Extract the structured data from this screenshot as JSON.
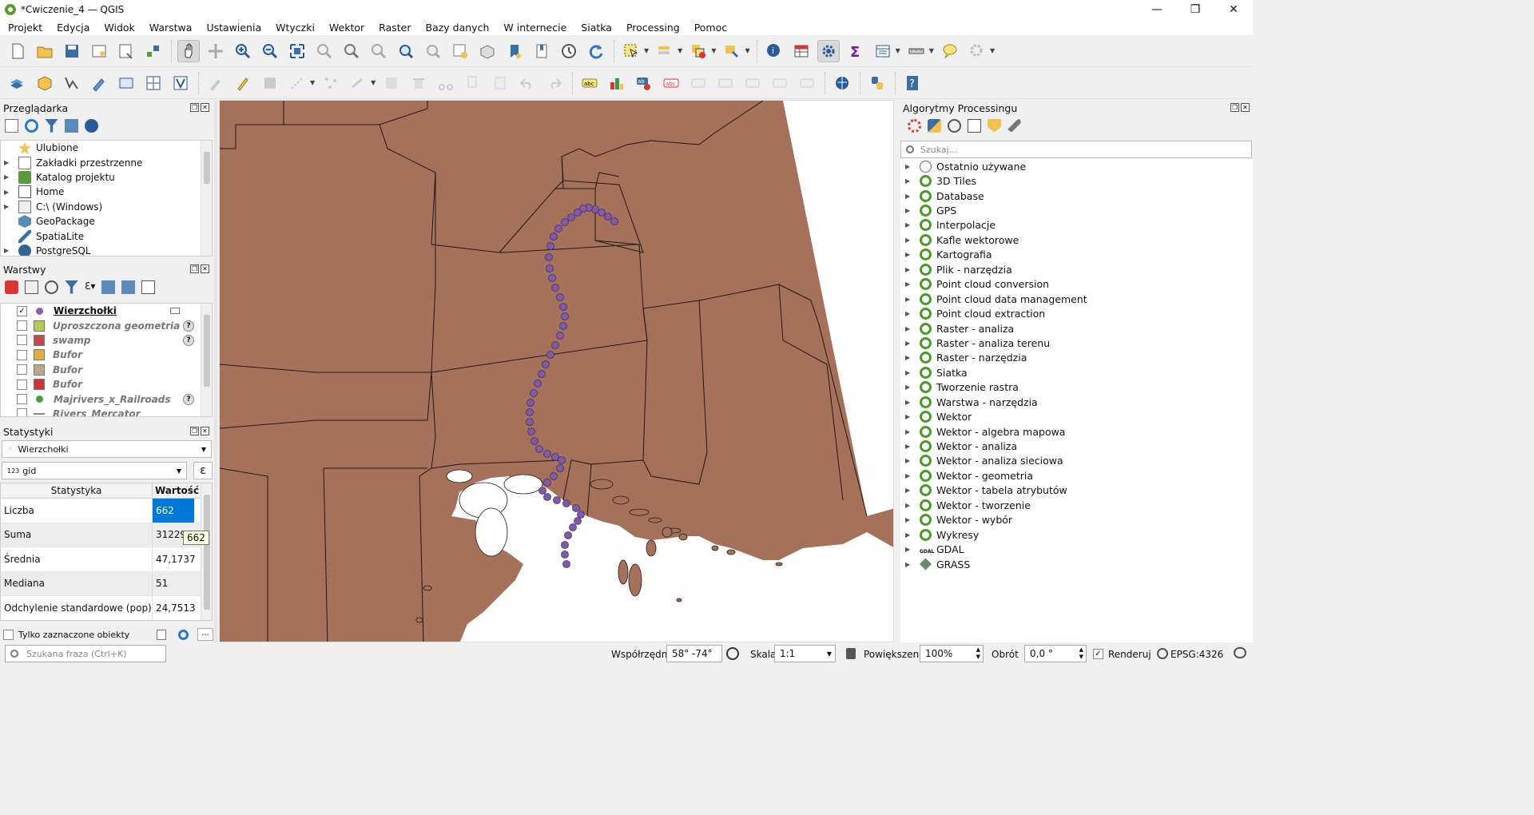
{
  "window": {
    "title": "*Cwiczenie_4 — QGIS",
    "controls": {
      "minimize": "—",
      "maximize": "❐",
      "close": "✕"
    }
  },
  "menu": [
    "Projekt",
    "Edycja",
    "Widok",
    "Warstwa",
    "Ustawienia",
    "Wtyczki",
    "Wektor",
    "Raster",
    "Bazy danych",
    "W internecie",
    "Siatka",
    "Processing",
    "Pomoc"
  ],
  "browser": {
    "title": "Przeglądarka",
    "items": [
      {
        "label": "Ulubione",
        "icon": "star-icon",
        "expand": false
      },
      {
        "label": "Zakładki przestrzenne",
        "icon": "bookmark-icon",
        "expand": true
      },
      {
        "label": "Katalog projektu",
        "icon": "folder-icon",
        "expand": true
      },
      {
        "label": "Home",
        "icon": "home-folder-icon",
        "expand": true
      },
      {
        "label": "C:\\ (Windows)",
        "icon": "drive-icon",
        "expand": true
      },
      {
        "label": "GeoPackage",
        "icon": "geopackage-icon",
        "expand": false
      },
      {
        "label": "SpatiaLite",
        "icon": "spatialite-icon",
        "expand": false
      },
      {
        "label": "PostgreSQL",
        "icon": "postgresql-icon",
        "expand": true
      }
    ]
  },
  "layers": {
    "title": "Warstwy",
    "items": [
      {
        "label": "Wierzchołki",
        "checked": "✓",
        "color": "#8a5fb0",
        "type": "point",
        "active": true,
        "warn": false
      },
      {
        "label": "Uproszczona geometria",
        "checked": "",
        "color": "#b5c85a",
        "type": "poly",
        "active": false,
        "warn": true
      },
      {
        "label": "swamp",
        "checked": "",
        "color": "#c8474e",
        "type": "poly",
        "active": false,
        "warn": true
      },
      {
        "label": "Bufor",
        "checked": "",
        "color": "#e0b040",
        "type": "poly",
        "active": false,
        "warn": false
      },
      {
        "label": "Bufor",
        "checked": "",
        "color": "#b8a88a",
        "type": "poly",
        "active": false,
        "warn": false
      },
      {
        "label": "Bufor",
        "checked": "",
        "color": "#d03535",
        "type": "poly",
        "active": false,
        "warn": false
      },
      {
        "label": "Majrivers_x_Railroads",
        "checked": "",
        "color": "#4a9a4a",
        "type": "point",
        "active": false,
        "warn": true
      },
      {
        "label": "Rivers_Mercator",
        "checked": "",
        "color": "#888888",
        "type": "line",
        "active": false,
        "warn": false
      }
    ],
    "warn_glyph": "?"
  },
  "statistics": {
    "title": "Statystyki",
    "layer": "Wierzchołki",
    "field_prefix": "123",
    "field": "gid",
    "expr_label": "ε",
    "headers": [
      "Statystyka",
      "Wartość"
    ],
    "rows": [
      {
        "name": "Liczba",
        "value": "662"
      },
      {
        "name": "Suma",
        "value": "31229"
      },
      {
        "name": "Średnia",
        "value": "47,1737"
      },
      {
        "name": "Mediana",
        "value": "51"
      },
      {
        "name": "Odchylenie standardowe (pop)",
        "value": "24,7513"
      }
    ],
    "tooltip": "662",
    "only_selected": "Tylko zaznaczone obiekty",
    "more_btn": "..."
  },
  "processing": {
    "title": "Algorytmy Processingu",
    "search_placeholder": "Szukaj...",
    "items": [
      {
        "label": "Ostatnio używane",
        "icon": "clock-icon"
      },
      {
        "label": "3D Tiles",
        "icon": "qgis-icon"
      },
      {
        "label": "Database",
        "icon": "qgis-icon"
      },
      {
        "label": "GPS",
        "icon": "qgis-icon"
      },
      {
        "label": "Interpolacje",
        "icon": "qgis-icon"
      },
      {
        "label": "Kafle wektorowe",
        "icon": "qgis-icon"
      },
      {
        "label": "Kartografia",
        "icon": "qgis-icon"
      },
      {
        "label": "Plik - narzędzia",
        "icon": "qgis-icon"
      },
      {
        "label": "Point cloud conversion",
        "icon": "qgis-icon"
      },
      {
        "label": "Point cloud data management",
        "icon": "qgis-icon"
      },
      {
        "label": "Point cloud extraction",
        "icon": "qgis-icon"
      },
      {
        "label": "Raster - analiza",
        "icon": "qgis-icon"
      },
      {
        "label": "Raster - analiza terenu",
        "icon": "qgis-icon"
      },
      {
        "label": "Raster - narzędzia",
        "icon": "qgis-icon"
      },
      {
        "label": "Siatka",
        "icon": "qgis-icon"
      },
      {
        "label": "Tworzenie rastra",
        "icon": "qgis-icon"
      },
      {
        "label": "Warstwa - narzędzia",
        "icon": "qgis-icon"
      },
      {
        "label": "Wektor",
        "icon": "qgis-icon"
      },
      {
        "label": "Wektor - algebra mapowa",
        "icon": "qgis-icon"
      },
      {
        "label": "Wektor - analiza",
        "icon": "qgis-icon"
      },
      {
        "label": "Wektor - analiza sieciowa",
        "icon": "qgis-icon"
      },
      {
        "label": "Wektor - geometria",
        "icon": "qgis-icon"
      },
      {
        "label": "Wektor - tabela atrybutów",
        "icon": "qgis-icon"
      },
      {
        "label": "Wektor - tworzenie",
        "icon": "qgis-icon"
      },
      {
        "label": "Wektor - wybór",
        "icon": "qgis-icon"
      },
      {
        "label": "Wykresy",
        "icon": "qgis-icon"
      },
      {
        "label": "GDAL",
        "icon": "gdal-icon"
      },
      {
        "label": "GRASS",
        "icon": "grass-icon"
      }
    ]
  },
  "statusbar": {
    "search_placeholder": "Szukana fraza (Ctrl+K)",
    "coord_label": "Współrzędne",
    "coord_value": "58°  -74°",
    "scale_label": "Skala",
    "scale_value": "1:1",
    "magnifier_label": "Powiększenie",
    "magnifier_value": "100%",
    "rotation_label": "Obrót",
    "rotation_value": "0,0 °",
    "render_label": "Renderuj",
    "render_check": "✓",
    "crs": "EPSG:4326"
  },
  "map": {
    "land_color": "#a6715a",
    "water_color": "#ffffff",
    "border_color": "#1a1a1a",
    "point_color": "#7f5aa8"
  }
}
